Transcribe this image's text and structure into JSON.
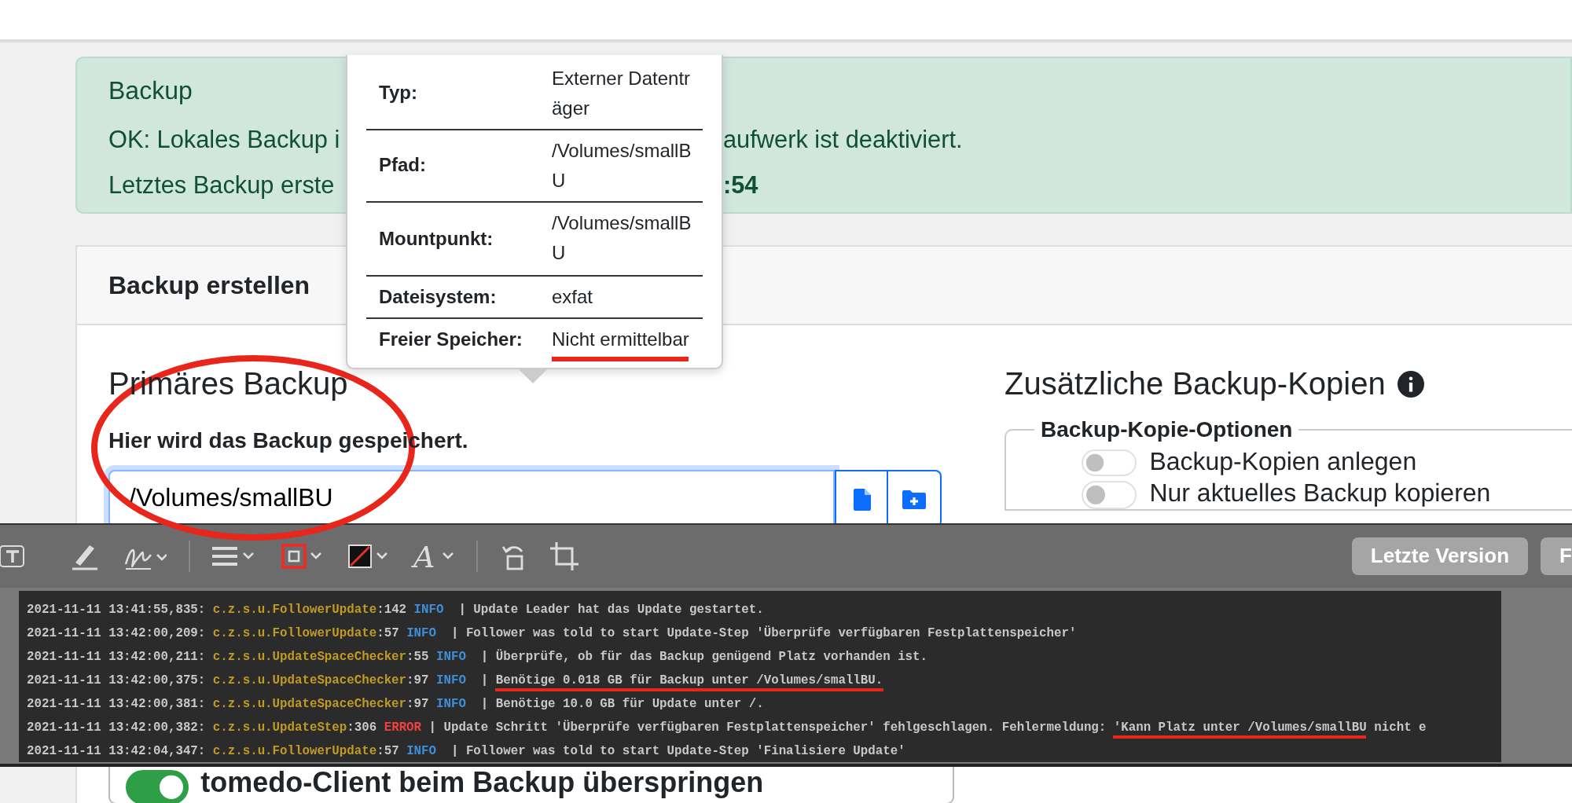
{
  "alert": {
    "title": "Backup",
    "line_1": [
      "OK: Lokales Backup i",
      "aufwerk ist deaktiviert."
    ],
    "line_2": [
      "Letztes Backup erste",
      ":54"
    ]
  },
  "card": {
    "header": "Backup erstellen",
    "primary": {
      "title": "Primäres Backup",
      "label": "Hier wird das Backup gespeichert.",
      "path_value": "/Volumes/smallBU"
    },
    "additional": {
      "title": "Zusätzliche Backup-Kopien",
      "legend": "Backup-Kopie-Optionen",
      "switches": [
        {
          "label": "Backup-Kopien anlegen",
          "on": false
        },
        {
          "label": "Nur aktuelles Backup kopieren",
          "on": false
        }
      ]
    },
    "bottom_switch": {
      "label": "tomedo-Client beim Backup überspringen",
      "on": true
    }
  },
  "popover": {
    "rows": [
      {
        "label": "Typ:",
        "value": "Externer Datenträger",
        "underlined": false
      },
      {
        "label": "Pfad:",
        "value": "/Volumes/smallBU",
        "underlined": false
      },
      {
        "label": "Mountpunkt:",
        "value": "/Volumes/smallBU",
        "underlined": false
      },
      {
        "label": "Dateisystem:",
        "value": "exfat",
        "underlined": false
      },
      {
        "label": "Freier Speicher:",
        "value": "Nicht ermittelbar",
        "underlined": true
      }
    ]
  },
  "tool_window": {
    "font_button": "A",
    "buttons": [
      "Letzte Version",
      "F"
    ],
    "log": [
      {
        "time": "2021-11-11 13:41:55,835:",
        "logger": "c.z.s.u.FollowerUpdate",
        "location": ":142",
        "level": "INFO",
        "kind": "info",
        "message": [
          {
            "text": "| Update Leader hat das Update gestartet.",
            "underlined": false
          }
        ]
      },
      {
        "time": "2021-11-11 13:42:00,209:",
        "logger": "c.z.s.u.FollowerUpdate",
        "location": ":57",
        "level": "INFO",
        "kind": "info",
        "message": [
          {
            "text": "| Follower was told to start Update-Step 'Überprüfe verfügbaren Festplattenspeicher'",
            "underlined": false
          }
        ]
      },
      {
        "time": "2021-11-11 13:42:00,211:",
        "logger": "c.z.s.u.UpdateSpaceChecker",
        "location": ":55",
        "level": "INFO",
        "kind": "info",
        "message": [
          {
            "text": "| Überprüfe, ob für das Backup genügend Platz vorhanden ist.",
            "underlined": false
          }
        ]
      },
      {
        "time": "2021-11-11 13:42:00,375:",
        "logger": "c.z.s.u.UpdateSpaceChecker",
        "location": ":97",
        "level": "INFO",
        "kind": "info",
        "message": [
          {
            "text": "| ",
            "underlined": false
          },
          {
            "text": "Benötige 0.018 GB für Backup unter /Volumes/smallBU.",
            "underlined": true
          }
        ]
      },
      {
        "time": "2021-11-11 13:42:00,381:",
        "logger": "c.z.s.u.UpdateSpaceChecker",
        "location": ":97",
        "level": "INFO",
        "kind": "info",
        "message": [
          {
            "text": "| Benötige 10.0 GB für Update unter /.",
            "underlined": false
          }
        ]
      },
      {
        "time": "2021-11-11 13:42:00,382:",
        "logger": "c.z.s.u.UpdateStep",
        "location": ":306",
        "level": "ERROR",
        "kind": "error",
        "message": [
          {
            "text": "| Update Schritt 'Überprüfe verfügbaren Festplattenspeicher' fehlgeschlagen. Fehlermeldung: ",
            "underlined": false
          },
          {
            "text": "'Kann Platz unter /Volumes/smallBU",
            "underlined": true
          },
          {
            "text": " nicht e",
            "underlined": false
          }
        ]
      },
      {
        "time": "2021-11-11 13:42:04,347:",
        "logger": "c.z.s.u.FollowerUpdate",
        "location": ":57",
        "level": "INFO",
        "kind": "info",
        "message": [
          {
            "text": "| Follower was told to start Update-Step 'Finalisiere Update'",
            "underlined": false
          }
        ]
      }
    ]
  }
}
